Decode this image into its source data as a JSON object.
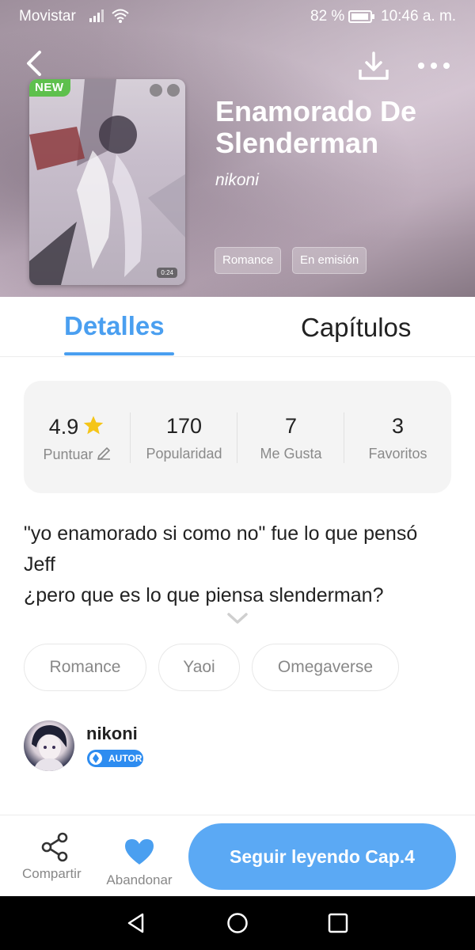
{
  "status_bar": {
    "carrier": "Movistar",
    "battery": "82 %",
    "time": "10:46 a. m."
  },
  "header": {
    "new_badge": "NEW",
    "cover_duration": "0:24",
    "title_line1": "Enamorado De",
    "title_line2": "Slenderman",
    "author": "nikoni",
    "chips": [
      "Romance",
      "En emisión"
    ]
  },
  "tabs": {
    "details": "Detalles",
    "chapters": "Capítulos"
  },
  "stats": {
    "rating_value": "4.9",
    "rating_label": "Puntuar",
    "popularity_value": "170",
    "popularity_label": "Popularidad",
    "likes_value": "7",
    "likes_label": "Me Gusta",
    "favorites_value": "3",
    "favorites_label": "Favoritos"
  },
  "description": {
    "line1": "\"yo enamorado si como no\" fue lo que pensó",
    "line2": "Jeff",
    "line3": "¿pero que es lo que piensa slenderman?"
  },
  "tags": [
    "Romance",
    "Yaoi",
    "Omegaverse"
  ],
  "author_row": {
    "name": "nikoni",
    "badge": "AUTOR"
  },
  "bottom_bar": {
    "share_label": "Compartir",
    "abandon_label": "Abandonar",
    "continue_label": "Seguir leyendo Cap.4"
  },
  "colors": {
    "accent": "#4a9ff0",
    "continue_button": "#5ba9f4",
    "new_badge": "#5ec04d",
    "star": "#f5c518"
  },
  "icons": [
    "signal-icon",
    "wifi-icon",
    "battery-icon",
    "back-arrow-icon",
    "download-icon",
    "more-icon",
    "star-icon",
    "pencil-icon",
    "chevron-down-icon",
    "share-icon",
    "heart-icon",
    "nav-back-icon",
    "nav-home-icon",
    "nav-recents-icon"
  ]
}
